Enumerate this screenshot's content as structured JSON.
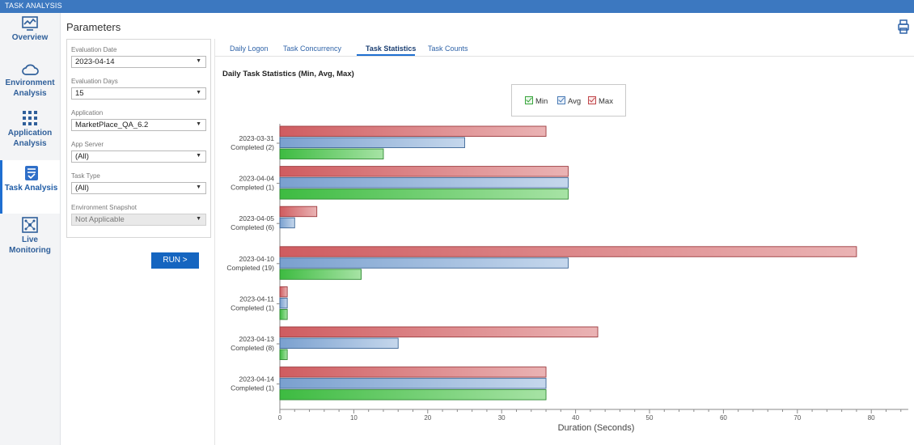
{
  "app": {
    "title": "TASK ANALYSIS"
  },
  "nav": [
    {
      "label": "Overview",
      "icon": "chart-line-icon",
      "active": false
    },
    {
      "label": "Environment Analysis",
      "icon": "cloud-icon",
      "active": false
    },
    {
      "label": "Application Analysis",
      "icon": "grid-icon",
      "active": false
    },
    {
      "label": "Task Analysis",
      "icon": "task-list-icon",
      "active": true
    },
    {
      "label": "Live Monitoring",
      "icon": "network-icon",
      "active": false
    }
  ],
  "params": {
    "heading": "Parameters",
    "fields": [
      {
        "label": "Evaluation Date",
        "value": "2023-04-14"
      },
      {
        "label": "Evaluation Days",
        "value": "15"
      },
      {
        "label": "Application",
        "value": "MarketPlace_QA_6.2"
      },
      {
        "label": "App Server",
        "value": "(All)"
      },
      {
        "label": "Task Type",
        "value": "(All)"
      },
      {
        "label": "Environment Snapshot",
        "value": "Not Applicable",
        "disabled": true
      }
    ],
    "run_label": "RUN >"
  },
  "tabs": [
    "Daily Logon",
    "Task Concurrency",
    "Task Statistics",
    "Task Counts"
  ],
  "active_tab": "Task Statistics",
  "colors": {
    "min": "#57c95a",
    "avg": "#8aaed6",
    "max": "#d9777a"
  },
  "chart_data": {
    "type": "bar",
    "orientation": "horizontal",
    "title": "Daily Task Statistics (Min, Avg, Max)",
    "xlabel": "Duration (Seconds)",
    "xlim": [
      0,
      85
    ],
    "xticks": [
      0,
      10,
      20,
      30,
      40,
      50,
      60,
      70,
      80
    ],
    "legend_position": "top-center",
    "categories": [
      [
        "2023-03-31",
        "Completed (2)"
      ],
      [
        "2023-04-04",
        "Completed (1)"
      ],
      [
        "2023-04-05",
        "Completed (6)"
      ],
      [
        "2023-04-10",
        "Completed (19)"
      ],
      [
        "2023-04-11",
        "Completed (1)"
      ],
      [
        "2023-04-13",
        "Completed (8)"
      ],
      [
        "2023-04-14",
        "Completed (1)"
      ]
    ],
    "series": [
      {
        "name": "Max",
        "values": [
          36,
          39,
          5,
          78,
          1,
          43,
          36
        ]
      },
      {
        "name": "Avg",
        "values": [
          25,
          39,
          2,
          39,
          1,
          16,
          36
        ]
      },
      {
        "name": "Min",
        "values": [
          14,
          39,
          0,
          11,
          1,
          1,
          36
        ]
      }
    ]
  }
}
